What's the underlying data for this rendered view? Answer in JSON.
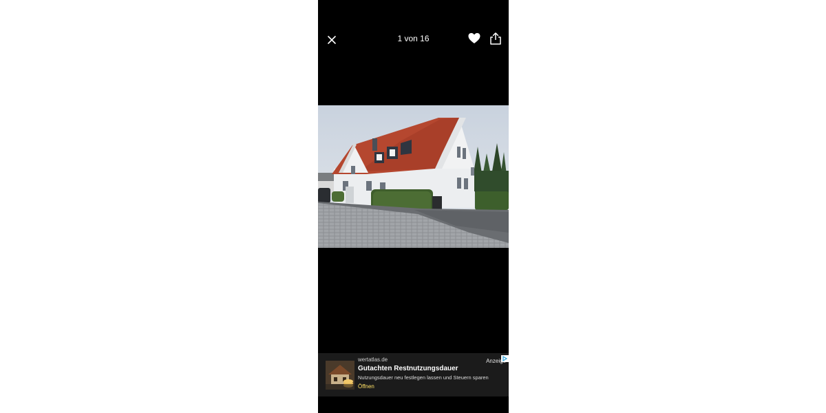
{
  "viewer": {
    "counter": "1 von 16",
    "icons": {
      "close": "close-icon",
      "favorite": "heart-icon",
      "share": "share-icon"
    }
  },
  "photo": {
    "subject": "house-photo"
  },
  "ad": {
    "domain": "wertatlas.de",
    "label": "Anzeige",
    "title": "Gutachten Restnutzungsdauer",
    "description": "Nutzungsdauer neu festlegen lassen und Steuern sparen",
    "cta": "Öffnen",
    "colors": {
      "cta": "#ffe066",
      "background": "#1b1b1b"
    }
  }
}
